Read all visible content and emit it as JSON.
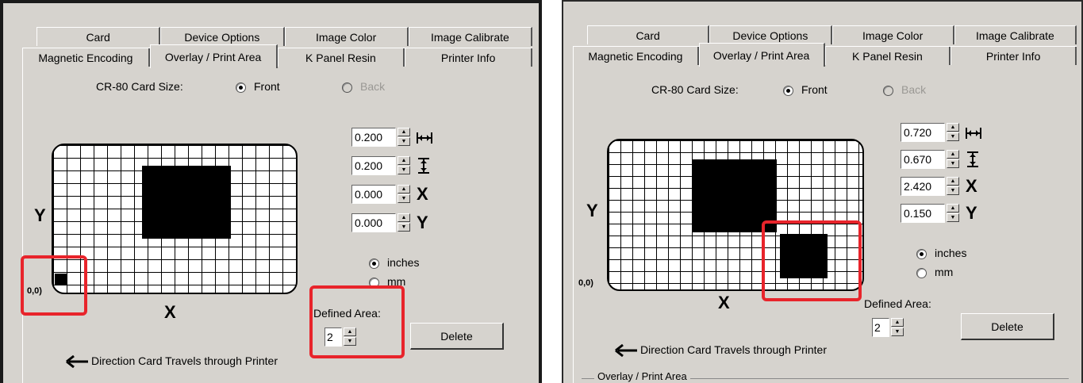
{
  "tabs_row1": [
    "Card",
    "Device Options",
    "Image Color",
    "Image Calibrate"
  ],
  "tabs_row2": [
    "Magnetic Encoding",
    "Overlay / Print Area",
    "K Panel Resin",
    "Printer Info"
  ],
  "active_tab": "Overlay / Print Area",
  "card_size_label": "CR-80 Card Size:",
  "front_label": "Front",
  "back_label": "Back",
  "inches_label": "inches",
  "mm_label": "mm",
  "defined_area_label": "Defined Area:",
  "delete_label": "Delete",
  "direction_label": "Direction Card Travels through Printer",
  "axis_x": "X",
  "axis_y": "Y",
  "origin_label": "0,0)",
  "unit_icons": [
    "width-arrows-icon",
    "height-arrows-icon",
    "X",
    "Y"
  ],
  "panels": {
    "left": {
      "width_value": "0.200",
      "height_value": "0.200",
      "x_value": "0.000",
      "y_value": "0.000",
      "defined_area_value": "2",
      "selected_unit": "inches",
      "selected_side": "Front"
    },
    "right": {
      "width_value": "0.720",
      "height_value": "0.670",
      "x_value": "2.420",
      "y_value": "0.150",
      "defined_area_value": "2",
      "selected_unit": "inches",
      "selected_side": "Front",
      "bottom_group_label": "Overlay / Print Area"
    }
  },
  "colors": {
    "panel_bg": "#d6d3ce",
    "highlight_red": "#e8242b"
  }
}
